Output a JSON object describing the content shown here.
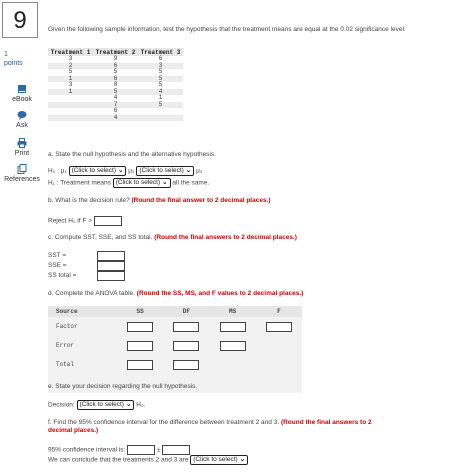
{
  "question": {
    "number": "9",
    "points_value": "1",
    "points_label": "points"
  },
  "sidebar": {
    "ebook": "eBook",
    "ask": "Ask",
    "print": "Print",
    "references": "References"
  },
  "prompt": "Given the following sample information, test the hypothesis that the treatment means are equal at the 0.02 significance level:",
  "data_table": {
    "headers": [
      "Treatment 1",
      "Treatment 2",
      "Treatment 3"
    ],
    "rows": [
      [
        "3",
        "9",
        "6"
      ],
      [
        "2",
        "6",
        "3"
      ],
      [
        "5",
        "5",
        "5"
      ],
      [
        "1",
        "6",
        "5"
      ],
      [
        "3",
        "8",
        "5"
      ],
      [
        "1",
        "5",
        "4"
      ],
      [
        "",
        "4",
        "1"
      ],
      [
        "",
        "7",
        "5"
      ],
      [
        "",
        "6",
        ""
      ],
      [
        "",
        "4",
        ""
      ]
    ]
  },
  "part_a": {
    "label": "a. State the null hypothesis and the alternative hypothesis.",
    "h0_prefix": "H₀ : μ₁",
    "h0_mid": "μ₂",
    "h0_suffix": "μ₃",
    "h1_prefix": "H₁ : Treatment means",
    "h1_suffix": "all the same.",
    "select_text": "(Click to select)"
  },
  "part_b": {
    "label": "b. What is the decision rule?",
    "instruction": "(Round the final answer to 2 decimal places.)",
    "reject_text": "Reject H₀ if F >"
  },
  "part_c": {
    "label": "c. Compute SST, SSE, and SS total.",
    "instruction": "(Round the final answers to 2 decimal places.)",
    "sst": "SST =",
    "sse": "SSE =",
    "sstotal": "SS total ="
  },
  "part_d": {
    "label": "d. Complete the ANOVA table.",
    "instruction": "(Round the SS, MS, and F values to 2 decimal places.)",
    "headers": {
      "source": "Source",
      "ss": "SS",
      "df": "DF",
      "ms": "MS",
      "f": "F"
    },
    "rows": [
      "Factor",
      "Error",
      "Total"
    ]
  },
  "part_e": {
    "label": "e. State your decision regarding the null hypothesis.",
    "decision_prefix": "Decision:",
    "decision_suffix": "H₀."
  },
  "part_f": {
    "label": "f. Find the 95% confidence interval for the difference between treatment 2 and 3.",
    "instruction_line1": "(Round the final answers to 2",
    "instruction_line2": "decimal places.)",
    "ci_prefix": "95% confidence interval is:",
    "pm": "±",
    "conclude_prefix": "We can conclude that the treatments 2 and 3 are"
  }
}
